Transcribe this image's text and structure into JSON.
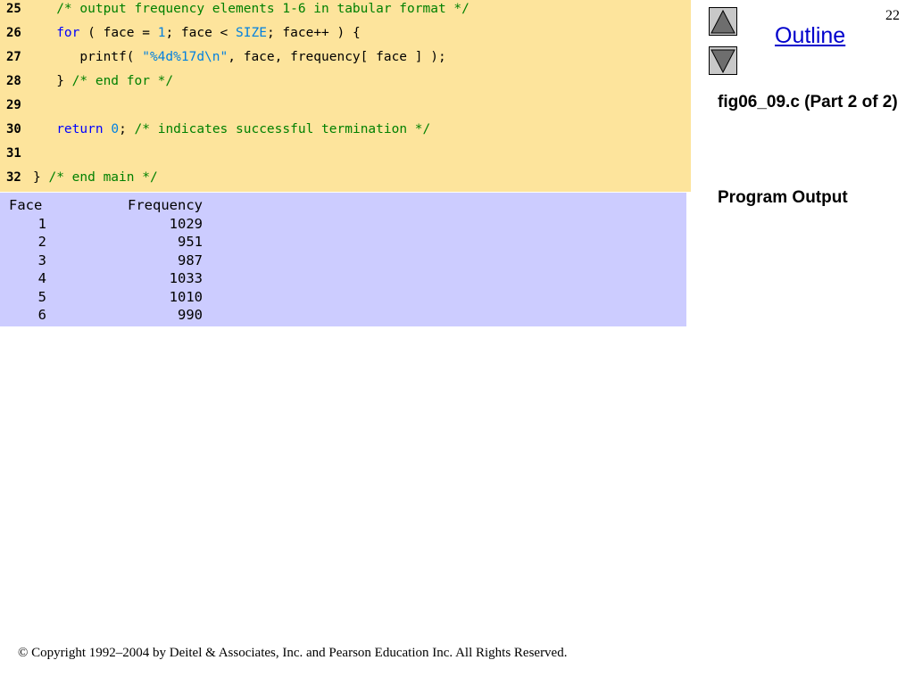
{
  "code_lines": [
    {
      "number": "25",
      "tokens": [
        {
          "t": "   ",
          "k": "pl"
        },
        {
          "t": "/* output frequency elements 1-6 in tabular format */",
          "k": "cm"
        }
      ]
    },
    {
      "number": "26",
      "tokens": [
        {
          "t": "   ",
          "k": "pl"
        },
        {
          "t": "for",
          "k": "kw"
        },
        {
          "t": " ( face = ",
          "k": "pl"
        },
        {
          "t": "1",
          "k": "lit"
        },
        {
          "t": "; face < ",
          "k": "pl"
        },
        {
          "t": "SIZE",
          "k": "lit"
        },
        {
          "t": "; face++ ) {",
          "k": "pl"
        }
      ]
    },
    {
      "number": "27",
      "tokens": [
        {
          "t": "      printf( ",
          "k": "pl"
        },
        {
          "t": "\"%4d%17d\\n\"",
          "k": "lit"
        },
        {
          "t": ", face, frequency[ face ] );",
          "k": "pl"
        }
      ]
    },
    {
      "number": "28",
      "tokens": [
        {
          "t": "   } ",
          "k": "pl"
        },
        {
          "t": "/* end for */",
          "k": "cm"
        }
      ]
    },
    {
      "number": "29",
      "tokens": []
    },
    {
      "number": "30",
      "tokens": [
        {
          "t": "   ",
          "k": "pl"
        },
        {
          "t": "return",
          "k": "kw"
        },
        {
          "t": " ",
          "k": "pl"
        },
        {
          "t": "0",
          "k": "lit"
        },
        {
          "t": "; ",
          "k": "pl"
        },
        {
          "t": "/* indicates successful termination */",
          "k": "cm"
        }
      ]
    },
    {
      "number": "31",
      "tokens": []
    },
    {
      "number": "32",
      "tokens": [
        {
          "t": "} ",
          "k": "pl"
        },
        {
          "t": "/* end main */",
          "k": "cm"
        }
      ]
    }
  ],
  "output": {
    "header": {
      "face": "Face",
      "frequency": "Frequency"
    },
    "rows": [
      {
        "face": "1",
        "frequency": "1029"
      },
      {
        "face": "2",
        "frequency": "951"
      },
      {
        "face": "3",
        "frequency": "987"
      },
      {
        "face": "4",
        "frequency": "1033"
      },
      {
        "face": "5",
        "frequency": "1010"
      },
      {
        "face": "6",
        "frequency": "990"
      }
    ]
  },
  "sidebar": {
    "page_number": "22",
    "outline": "Outline",
    "file_label": "fig06_09.c (Part 2 of 2)",
    "program_output": "Program Output",
    "nav_up_icon": "triangle-up-icon",
    "nav_down_icon": "triangle-down-icon"
  },
  "footer": {
    "copyright": "© Copyright 1992–2004 by Deitel & Associates, Inc. and Pearson Education Inc. All Rights Reserved."
  },
  "colors": {
    "code_background": "#fde49c",
    "output_background": "#ccccff",
    "keyword": "#0000ff",
    "comment": "#008000",
    "literal": "#0080e0",
    "link": "#0000cc"
  }
}
